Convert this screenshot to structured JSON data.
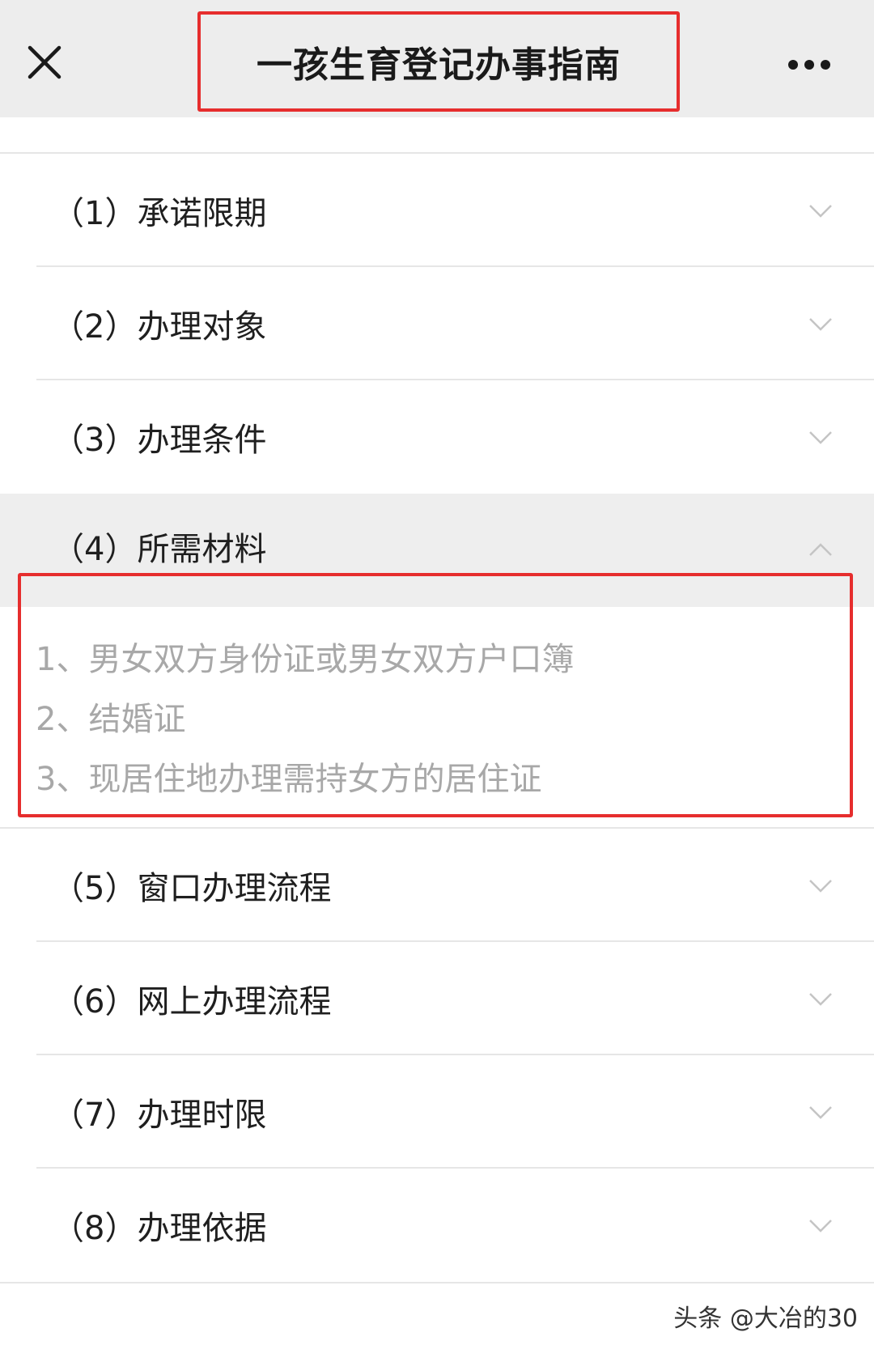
{
  "header": {
    "title": "一孩生育登记办事指南",
    "close_icon": "close-icon",
    "more_icon": "more-options-icon"
  },
  "sections": [
    {
      "label": "（1）承诺限期",
      "icon": "chevron-down-icon",
      "expanded": false
    },
    {
      "label": "（2）办理对象",
      "icon": "chevron-down-icon",
      "expanded": false
    },
    {
      "label": "（3）办理条件",
      "icon": "chevron-down-icon",
      "expanded": false
    },
    {
      "label": "（4）所需材料",
      "icon": "chevron-up-icon",
      "expanded": true
    },
    {
      "label": "（5）窗口办理流程",
      "icon": "chevron-down-icon",
      "expanded": false
    },
    {
      "label": "（6）网上办理流程",
      "icon": "chevron-down-icon",
      "expanded": false
    },
    {
      "label": "（7）办理时限",
      "icon": "chevron-down-icon",
      "expanded": false
    },
    {
      "label": "（8）办理依据",
      "icon": "chevron-down-icon",
      "expanded": false
    }
  ],
  "materials": [
    "1、男女双方身份证或男女双方户口簿",
    "2、结婚证",
    "3、现居住地办理需持女方的居住证"
  ],
  "colors": {
    "highlight_border": "#e62d2d",
    "header_bg": "#ededed",
    "expanded_bg": "#eeeeee",
    "muted_text": "#a8a8a8"
  },
  "watermark": "头条 @大冶的30"
}
